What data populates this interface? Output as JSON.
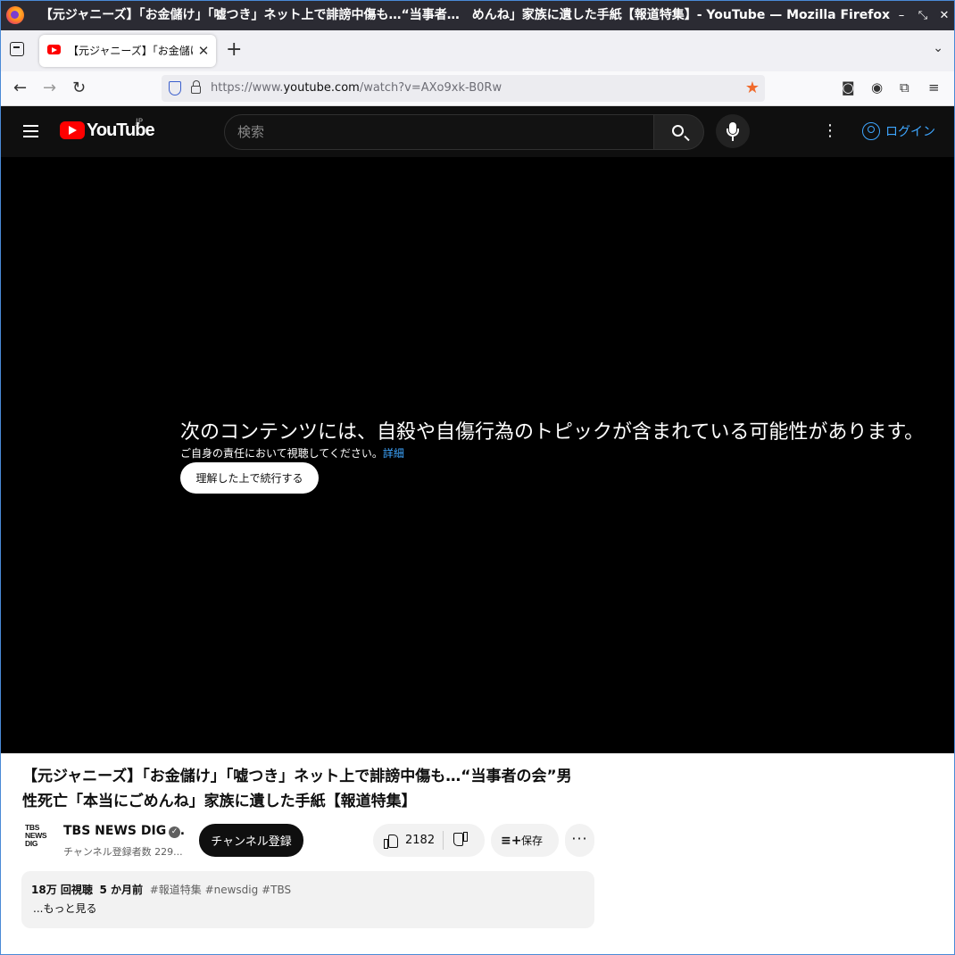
{
  "window": {
    "title": "【元ジャニーズ】「お金儲け」「嘘つき」ネット上で誹謗中傷も…“当事者…　めんね」家族に遺した手紙【報道特集】- YouTube — Mozilla Firefox"
  },
  "tab": {
    "title": "【元ジャニーズ】「お金儲け」「嘘つき」"
  },
  "urlbar": {
    "prefix": "https://www.",
    "domain": "youtube.com",
    "path": "/watch?v=AXo9xk-B0Rw"
  },
  "youtube": {
    "logo_text": "YouTube",
    "region": "JP",
    "search_placeholder": "検索",
    "signin_label": "ログイン"
  },
  "player": {
    "warning_title": "次のコンテンツには、自殺や自傷行為のトピックが含まれている可能性があります。",
    "warning_sub": "ご自身の責任において視聴してください。",
    "details_link": "詳細",
    "continue_label": "理解した上で続行する"
  },
  "video": {
    "title": "【元ジャニーズ】「お金儲け」「嘘つき」ネット上で誹謗中傷も…“当事者の会”男性死亡「本当にごめんね」家族に遺した手紙【報道特集】",
    "channel_logo": [
      "TBS",
      "NEWS",
      "DIG"
    ],
    "channel_name": "TBS NEWS DIG ...",
    "verified_mark": "✓",
    "subscribers": "チャンネル登録者数 229...",
    "subscribe_label": "チャンネル登録",
    "like_count": "2182",
    "save_label": "保存",
    "views": "18万 回視聴",
    "age": "5 か月前",
    "tags": "#報道特集 #newsdig #TBS",
    "show_more": "...もっと見る"
  },
  "colors": {
    "yt_red": "#ff0000",
    "link_blue": "#3ea6ff",
    "titlebar": "#2b2b33"
  }
}
